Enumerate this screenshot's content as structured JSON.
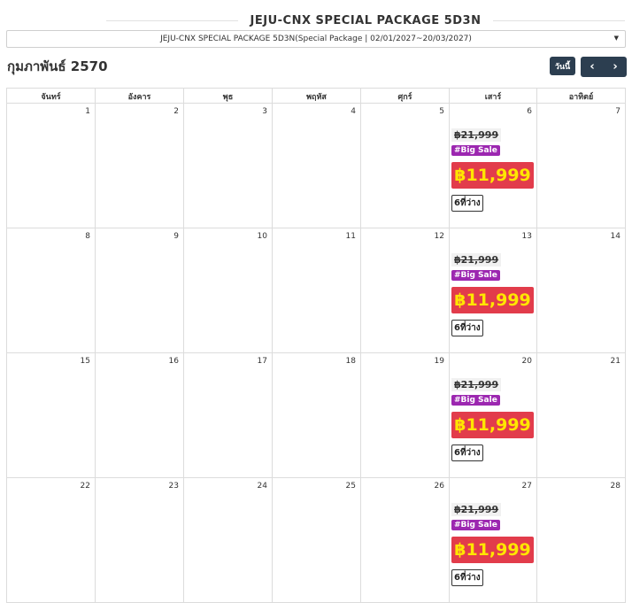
{
  "header": {
    "title": "JEJU-CNX SPECIAL PACKAGE 5D3N"
  },
  "package_select": {
    "value": "JEJU-CNX SPECIAL PACKAGE 5D3N(Special Package | 02/01/2027~20/03/2027)"
  },
  "calendar_nav": {
    "month_title": "กุมภาพันธ์ 2570",
    "today_label": "วันนี้",
    "prev_label": "‹",
    "next_label": "›"
  },
  "weekdays": [
    "จันทร์",
    "อังคาร",
    "พุธ",
    "พฤหัส",
    "ศุกร์",
    "เสาร์",
    "อาทิตย์"
  ],
  "weeks": [
    [
      "1",
      "2",
      "3",
      "4",
      "5",
      "6",
      "7"
    ],
    [
      "8",
      "9",
      "10",
      "11",
      "12",
      "13",
      "14"
    ],
    [
      "15",
      "16",
      "17",
      "18",
      "19",
      "20",
      "21"
    ],
    [
      "22",
      "23",
      "24",
      "25",
      "26",
      "27",
      "28"
    ]
  ],
  "offers": {
    "old_price": "฿21,999",
    "badge": "#Big Sale",
    "price": "฿11,999",
    "seats": "6ที่ว่าง",
    "days": [
      "6",
      "13",
      "20",
      "27"
    ]
  },
  "colors": {
    "nav_button": "#2c3e50",
    "price_bg": "#e23c4b",
    "price_text": "#ffe600",
    "badge_bg": "#9c27b0"
  }
}
